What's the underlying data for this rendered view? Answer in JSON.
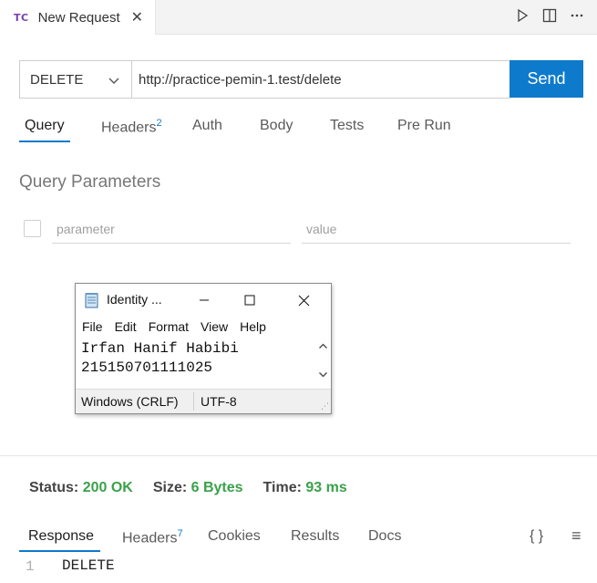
{
  "tab": {
    "logo": "TC",
    "title": "New Request",
    "close": "✕"
  },
  "tab_actions": {
    "run_icon": "play-icon",
    "split_icon": "split-editor-icon",
    "more_icon": "more-icon"
  },
  "request": {
    "method": "DELETE",
    "url": "http://practice-pemin-1.test/delete",
    "send_label": "Send"
  },
  "request_tabs": [
    {
      "label": "Query",
      "badge": ""
    },
    {
      "label": "Headers",
      "badge": "2"
    },
    {
      "label": "Auth",
      "badge": ""
    },
    {
      "label": "Body",
      "badge": ""
    },
    {
      "label": "Tests",
      "badge": ""
    },
    {
      "label": "Pre Run",
      "badge": ""
    }
  ],
  "query": {
    "title": "Query Parameters",
    "param_placeholder": "parameter",
    "value_placeholder": "value"
  },
  "notepad": {
    "title": "Identity ...",
    "menu": [
      "File",
      "Edit",
      "Format",
      "View",
      "Help"
    ],
    "lines": [
      "Irfan Hanif Habibi",
      "215150701111025"
    ],
    "status_eol": "Windows (CRLF)",
    "status_encoding": "UTF-8"
  },
  "response_status": {
    "status_label": "Status:",
    "status_value": "200 OK",
    "size_label": "Size:",
    "size_value": "6 Bytes",
    "time_label": "Time:",
    "time_value": "93 ms",
    "value_color": "#3aa14a"
  },
  "response_tabs": [
    {
      "label": "Response",
      "badge": ""
    },
    {
      "label": "Headers",
      "badge": "7"
    },
    {
      "label": "Cookies",
      "badge": ""
    },
    {
      "label": "Results",
      "badge": ""
    },
    {
      "label": "Docs",
      "badge": ""
    }
  ],
  "response_icons": {
    "braces": "{ }",
    "menu": "≡"
  },
  "response_body": {
    "line_number": "1",
    "text": "DELETE"
  },
  "colors": {
    "accent": "#0e7acc",
    "success": "#3aa14a"
  }
}
